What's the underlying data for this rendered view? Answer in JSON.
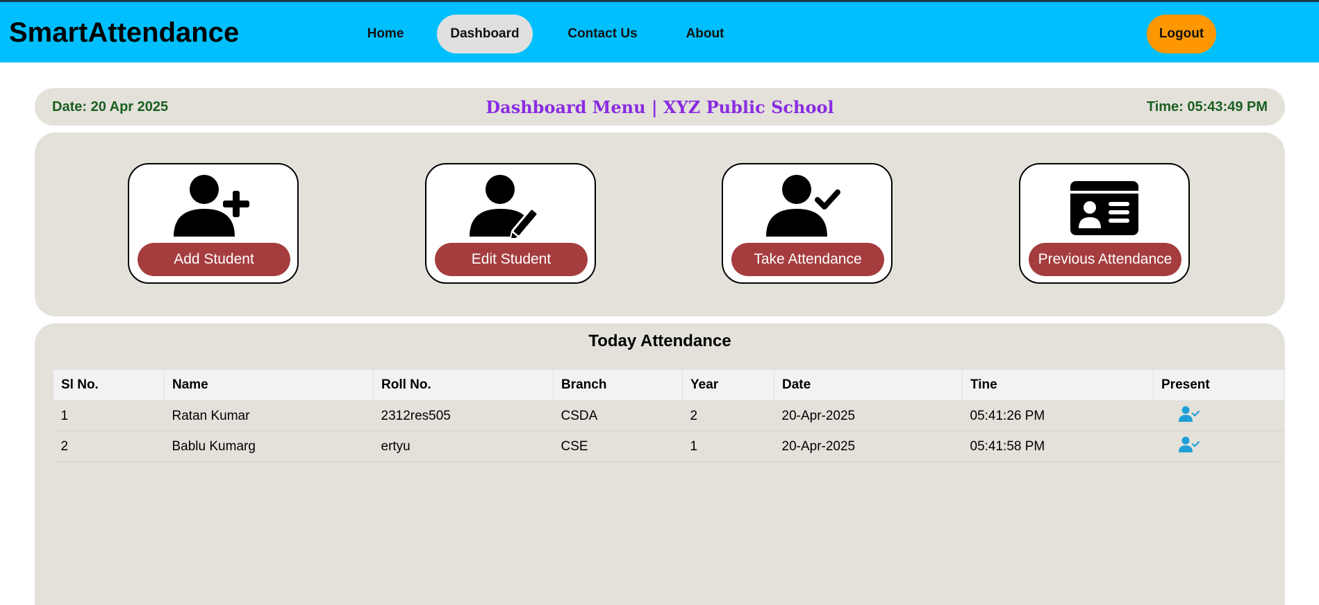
{
  "app": {
    "title": "SmartAttendance"
  },
  "nav": {
    "items": [
      {
        "label": "Home"
      },
      {
        "label": "Dashboard"
      },
      {
        "label": "Contact Us"
      },
      {
        "label": "About"
      }
    ],
    "logout_label": "Logout"
  },
  "info": {
    "date": "Date: 20 Apr 2025",
    "menu_title": "Dashboard Menu | XYZ Public School",
    "time": "Time: 05:43:49 PM"
  },
  "cards": [
    {
      "label": "Add Student",
      "icon": "user-plus-icon"
    },
    {
      "label": "Edit Student",
      "icon": "user-edit-icon"
    },
    {
      "label": "Take Attendance",
      "icon": "user-check-icon"
    },
    {
      "label": "Previous Attendance",
      "icon": "id-card-icon"
    }
  ],
  "attendance": {
    "title": "Today Attendance",
    "columns": [
      "Sl No.",
      "Name",
      "Roll No.",
      "Branch",
      "Year",
      "Date",
      "Tine",
      "Present"
    ],
    "rows": [
      {
        "sl": "1",
        "name": "Ratan Kumar",
        "roll": "2312res505",
        "branch": "CSDA",
        "year": "2",
        "date": "20-Apr-2025",
        "time": "05:41:26 PM",
        "present_icon": "user-check-icon"
      },
      {
        "sl": "2",
        "name": "Bablu Kumarg",
        "roll": "ertyu",
        "branch": "CSE",
        "year": "1",
        "date": "20-Apr-2025",
        "time": "05:41:58 PM",
        "present_icon": "user-check-icon"
      }
    ]
  },
  "colors": {
    "topbar": "#00bfff",
    "logout": "#ff9800",
    "card_button": "#a53d3f",
    "title_purple": "#8a2be2",
    "date_green": "#1b5e20",
    "present_icon": "#1e9fd8"
  }
}
